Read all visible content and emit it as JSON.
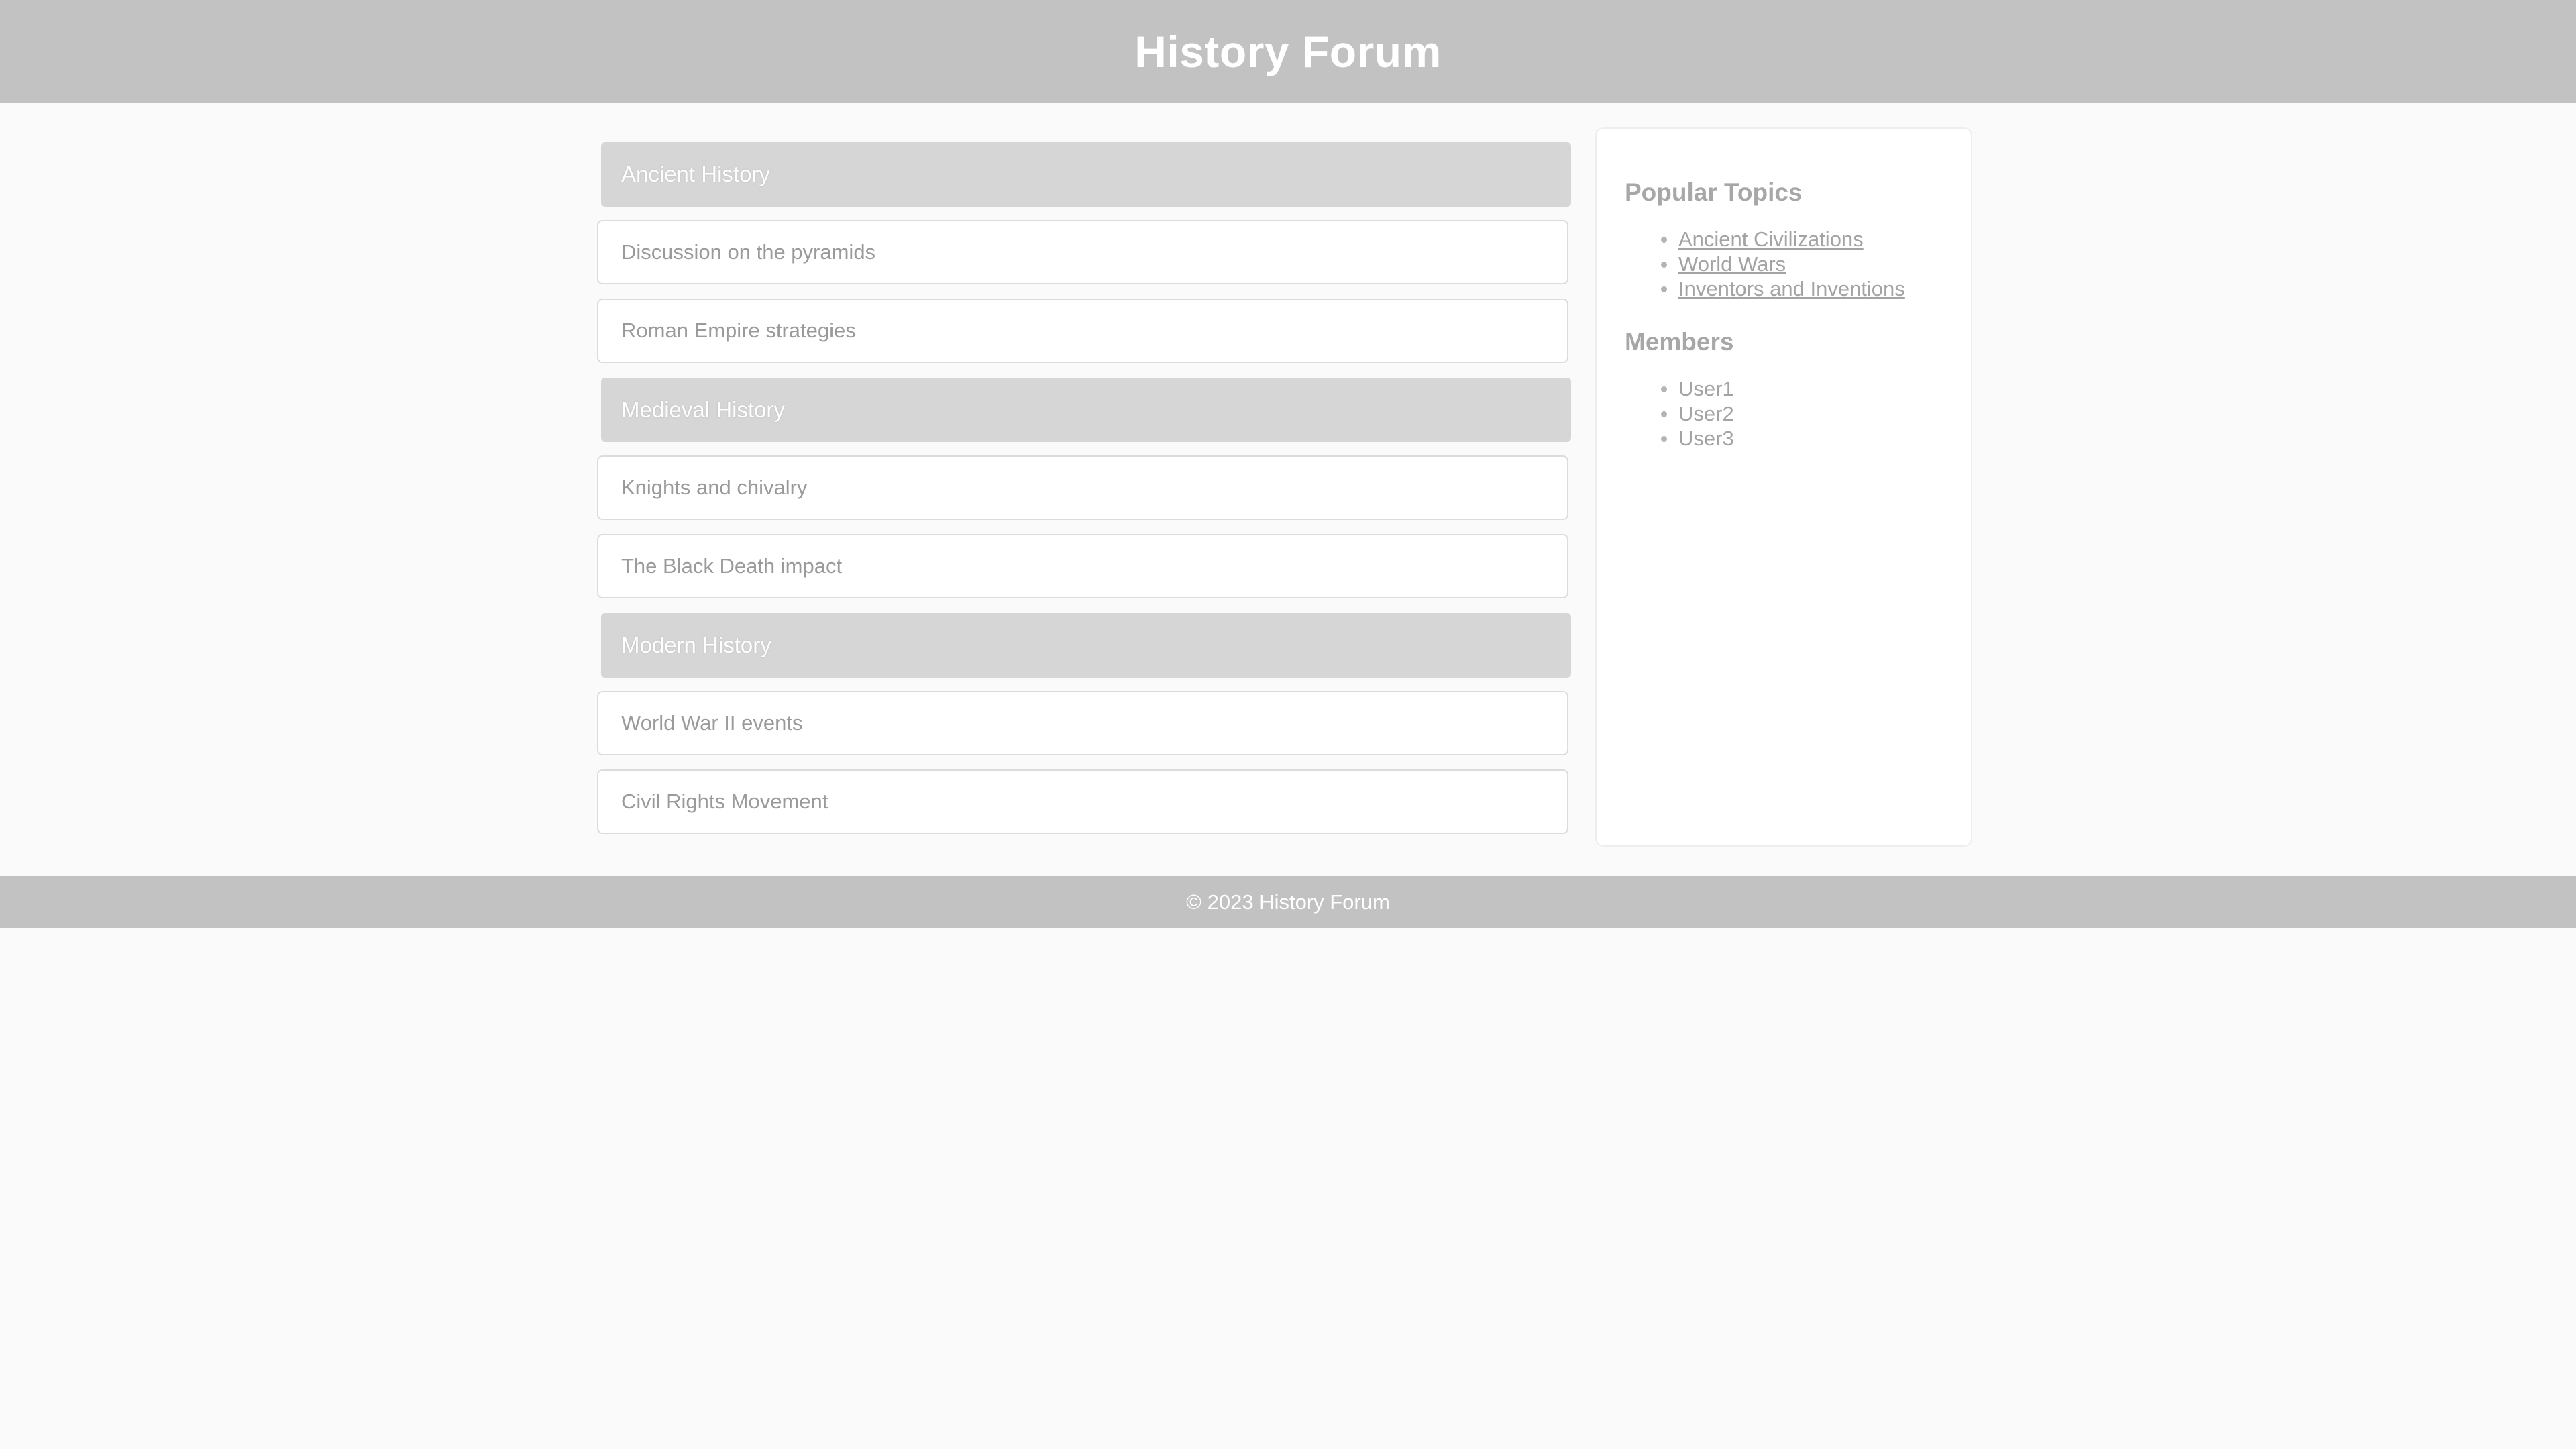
{
  "header": {
    "title": "History Forum"
  },
  "threads": {
    "categories": [
      {
        "title": "Ancient History",
        "items": [
          "Discussion on the pyramids",
          "Roman Empire strategies"
        ]
      },
      {
        "title": "Medieval History",
        "items": [
          "Knights and chivalry",
          "The Black Death impact"
        ]
      },
      {
        "title": "Modern History",
        "items": [
          "World War II events",
          "Civil Rights Movement"
        ]
      }
    ]
  },
  "sidebar": {
    "popular_title": "Popular Topics",
    "popular_topics": [
      "Ancient Civilizations",
      "World Wars",
      "Inventors and Inventions"
    ],
    "members_title": "Members",
    "members": [
      "User1",
      "User2",
      "User3"
    ]
  },
  "footer": {
    "text": "© 2023 History Forum"
  },
  "colors": {
    "header_bg": "#c2c2c2",
    "category_bg": "#d6d6d6",
    "page_bg": "#fafafa"
  }
}
